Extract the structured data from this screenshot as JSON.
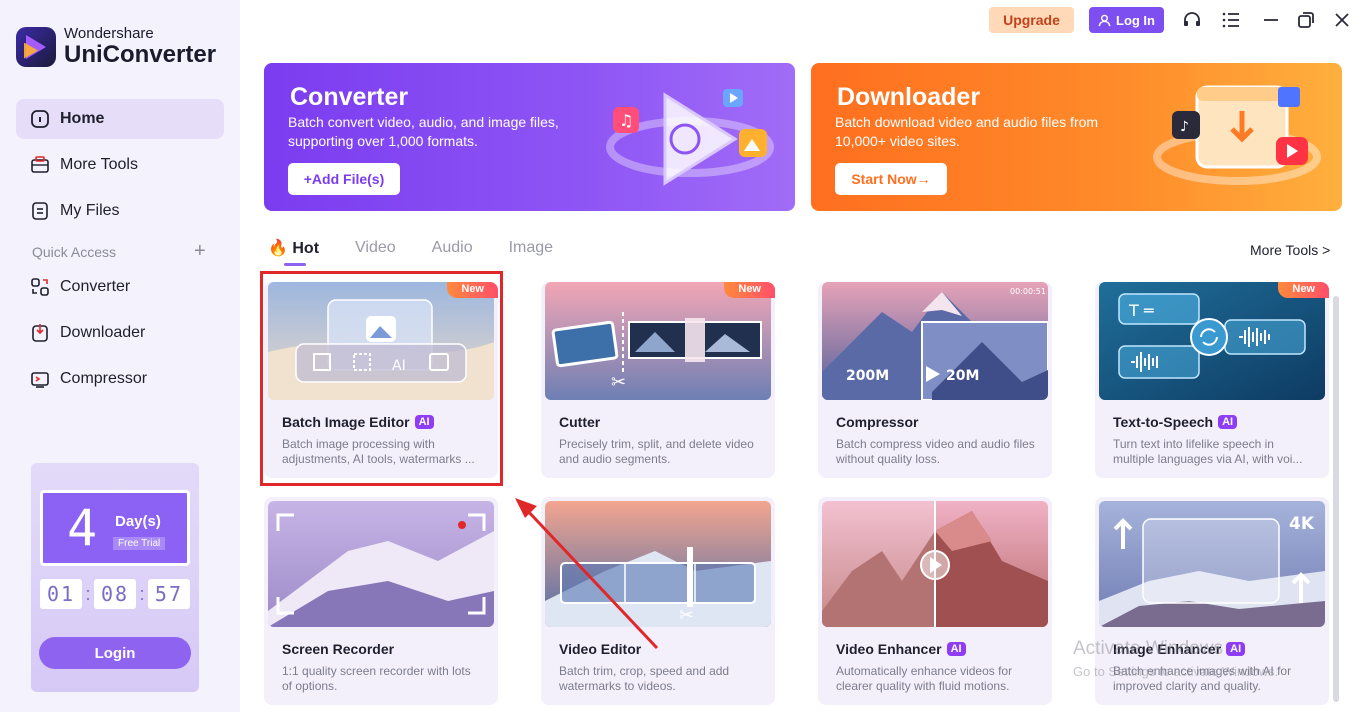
{
  "brand": {
    "sub": "Wondershare",
    "main": "UniConverter"
  },
  "sidebar": {
    "items": [
      {
        "label": "Home",
        "icon": "home-icon"
      },
      {
        "label": "More Tools",
        "icon": "toolbox-icon"
      },
      {
        "label": "My Files",
        "icon": "file-icon"
      }
    ],
    "quick_access_label": "Quick Access",
    "quick_items": [
      {
        "label": "Converter",
        "icon": "converter-icon"
      },
      {
        "label": "Downloader",
        "icon": "download-icon"
      },
      {
        "label": "Compressor",
        "icon": "compress-icon"
      }
    ]
  },
  "trial": {
    "days": "4",
    "day_label": "Day(s)",
    "trial_label": "Free Trial",
    "clock": [
      "01",
      "08",
      "57"
    ],
    "login_label": "Login"
  },
  "topbar": {
    "upgrade_label": "Upgrade",
    "login_label": "Log In"
  },
  "banners": {
    "converter": {
      "title": "Converter",
      "desc": "Batch convert video, audio, and image files, supporting over 1,000 formats.",
      "button": "+Add File(s)"
    },
    "downloader": {
      "title": "Downloader",
      "desc": "Batch download video and audio files from 10,000+ video sites.",
      "button": "Start Now→"
    }
  },
  "tabs": [
    "Hot",
    "Video",
    "Audio",
    "Image"
  ],
  "more_tools_link": "More Tools >",
  "cards": [
    {
      "title": "Batch Image Editor",
      "ai": "AI",
      "new": "New",
      "desc": "Batch image processing with adjustments, AI tools, watermarks ..."
    },
    {
      "title": "Cutter",
      "new": "New",
      "desc": "Precisely trim, split, and delete video and audio segments."
    },
    {
      "title": "Compressor",
      "desc": "Batch compress video and audio files without quality loss.",
      "thumb_from": "200M",
      "thumb_to": "20M",
      "thumb_time": "00:00:51"
    },
    {
      "title": "Text-to-Speech",
      "ai": "AI",
      "new": "New",
      "desc": "Turn text into lifelike speech in multiple languages via AI, with voi..."
    },
    {
      "title": "Screen Recorder",
      "desc": "1:1 quality screen recorder with lots of options."
    },
    {
      "title": "Video Editor",
      "desc": "Batch trim, crop, speed and add watermarks to videos."
    },
    {
      "title": "Video Enhancer",
      "ai": "AI",
      "desc": "Automatically enhance videos for clearer quality with fluid motions."
    },
    {
      "title": "Image Enhancer",
      "ai": "AI",
      "desc": "Batch enhance images with AI for improved clarity and quality.",
      "thumb_badge": "4K"
    }
  ],
  "watermark": {
    "line1": "Activate Windows",
    "line2": "Go to Settings to activate Windows."
  },
  "colors": {
    "accent": "#8e63f0",
    "converter": "#7b3cf0",
    "downloader": "#ff7a24",
    "highlight": "#e0282a"
  }
}
